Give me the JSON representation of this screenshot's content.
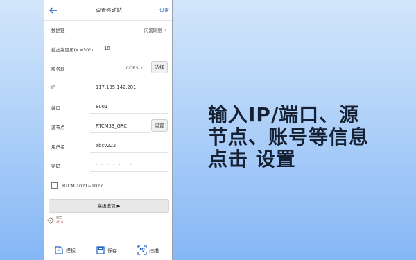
{
  "topbar": {
    "title": "设置移动站",
    "action": "设置"
  },
  "form": {
    "datalink": {
      "label": "数据链",
      "value": "内置网络"
    },
    "cutoff": {
      "label": "截止高度角(<=30°)",
      "value": "10"
    },
    "server": {
      "label": "服务器",
      "value": "CORS",
      "button": "选择"
    },
    "ip": {
      "label": "IP",
      "value": "117.135.142.201"
    },
    "port": {
      "label": "端口",
      "value": "8001"
    },
    "source": {
      "label": "源节点",
      "value": "RTCM33_GRC",
      "button": "设置"
    },
    "username": {
      "label": "用户名",
      "value": "abcv222"
    },
    "password": {
      "label": "密码",
      "value": "· · · · · · · ·"
    },
    "rtcm": {
      "label": "RTCM 1021~1027",
      "checked": false
    }
  },
  "advanced": {
    "label": "高级选项 ▶"
  },
  "status": {
    "label": "固定",
    "value": "40.0"
  },
  "bottom": {
    "template": "模板",
    "save": "保存",
    "scan": "扫描"
  },
  "caption": {
    "line1": "输入IP/端口、源",
    "line2": "节点、账号等信息",
    "line3": "点击 设置"
  }
}
